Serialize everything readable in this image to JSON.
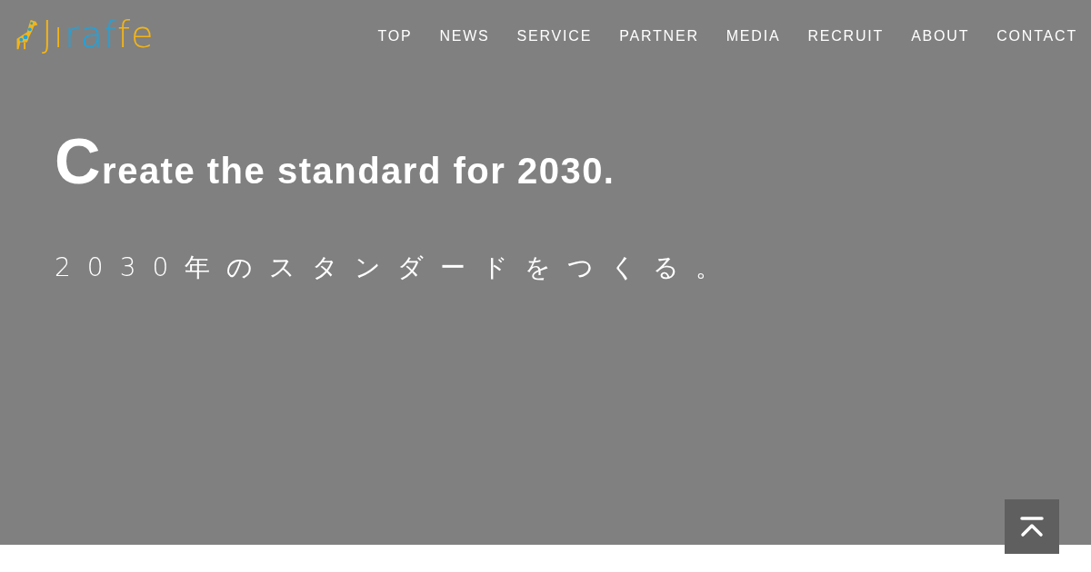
{
  "logo": {
    "letters": [
      {
        "char": "J",
        "color": "#f2b418"
      },
      {
        "char": "ı",
        "color": "#f2b418"
      },
      {
        "char": "r",
        "color": "#1fa3dc"
      },
      {
        "char": "a",
        "color": "#1fa3dc"
      },
      {
        "char": "f",
        "color": "#1fa3dc"
      },
      {
        "char": "f",
        "color": "#f2b418"
      },
      {
        "char": "e",
        "color": "#f2b418"
      }
    ]
  },
  "nav": [
    {
      "label": "TOP"
    },
    {
      "label": "NEWS"
    },
    {
      "label": "SERVICE"
    },
    {
      "label": "PARTNER"
    },
    {
      "label": "MEDIA"
    },
    {
      "label": "RECRUIT"
    },
    {
      "label": "ABOUT"
    },
    {
      "label": "CONTACT"
    }
  ],
  "hero": {
    "headline": "Create the standard for 2030.",
    "subtitle": "2030年のスタンダードをつくる。"
  },
  "back_to_top": {
    "kind": "button"
  }
}
